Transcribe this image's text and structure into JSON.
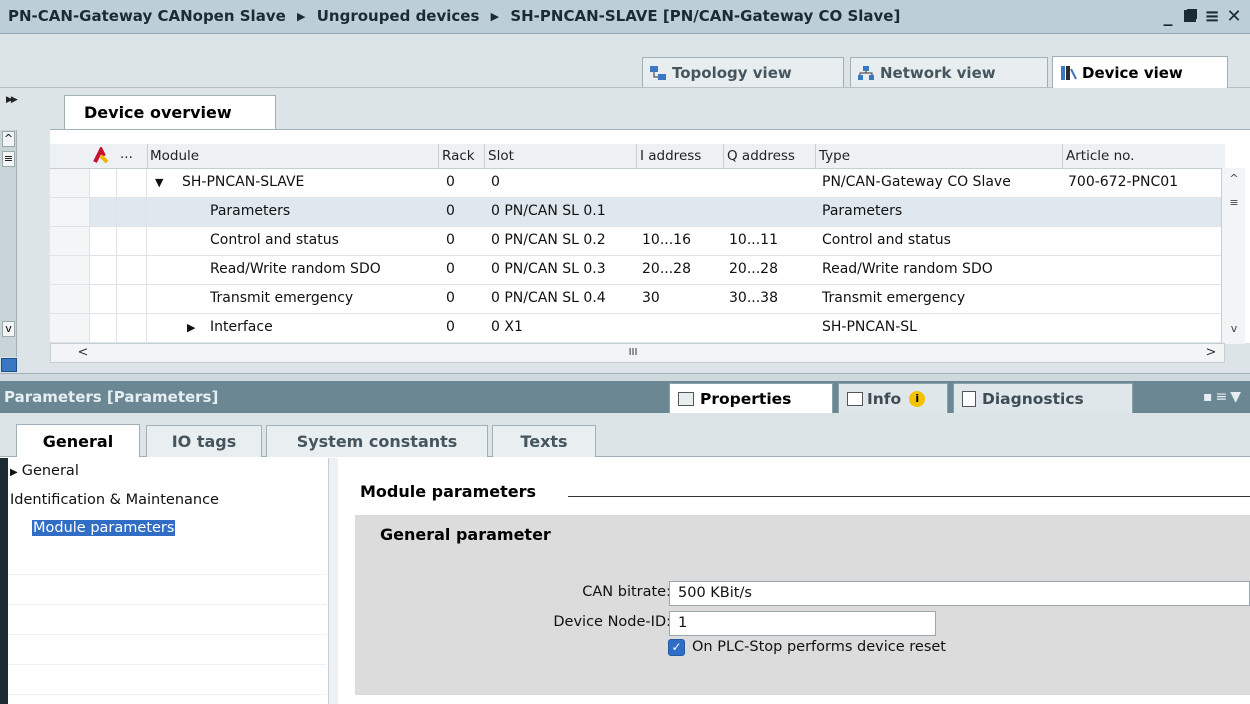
{
  "titlebar": {
    "crumbs": [
      "PN-CAN-Gateway CANopen Slave",
      "Ungrouped devices",
      "SH-PNCAN-SLAVE [PN/CAN-Gateway CO Slave]"
    ],
    "separator": "▶",
    "minimize": "_",
    "restore": "▪",
    "maximize": "≡",
    "close": "✕"
  },
  "views": {
    "topology": "Topology view",
    "network": "Network view",
    "device": "Device view"
  },
  "overview": {
    "tab_label": "Device overview",
    "ellipsis": "...",
    "columns": {
      "module": "Module",
      "rack": "Rack",
      "slot": "Slot",
      "iaddr": "I address",
      "qaddr": "Q address",
      "type": "Type",
      "article": "Article no."
    },
    "rows": [
      {
        "module": "SH-PNCAN-SLAVE",
        "rack": "0",
        "slot": "0",
        "iaddr": "",
        "qaddr": "",
        "type": "PN/CAN-Gateway CO Slave",
        "article": "700-672-PNC01",
        "expander": "▼"
      },
      {
        "module": "Parameters",
        "rack": "0",
        "slot": "0 PN/CAN SL 0.1",
        "iaddr": "",
        "qaddr": "",
        "type": "Parameters",
        "article": "",
        "expander": ""
      },
      {
        "module": "Control and status",
        "rack": "0",
        "slot": "0 PN/CAN SL 0.2",
        "iaddr": "10...16",
        "qaddr": "10...11",
        "type": "Control and status",
        "article": "",
        "expander": ""
      },
      {
        "module": "Read/Write random SDO",
        "rack": "0",
        "slot": "0 PN/CAN SL 0.3",
        "iaddr": "20...28",
        "qaddr": "20...28",
        "type": "Read/Write random SDO",
        "article": "",
        "expander": ""
      },
      {
        "module": "Transmit emergency",
        "rack": "0",
        "slot": "0 PN/CAN SL 0.4",
        "iaddr": "30",
        "qaddr": "30...38",
        "type": "Transmit emergency",
        "article": "",
        "expander": ""
      },
      {
        "module": "Interface",
        "rack": "0",
        "slot": "0 X1",
        "iaddr": "",
        "qaddr": "",
        "type": "SH-PNCAN-SL",
        "article": "",
        "expander": "▶"
      }
    ],
    "hscroll_mid": "III"
  },
  "properties": {
    "title": "Parameters [Parameters]",
    "tabs": {
      "properties": "Properties",
      "info": "Info",
      "diagnostics": "Diagnostics"
    },
    "subtabs": [
      "General",
      "IO tags",
      "System constants",
      "Texts"
    ],
    "nav": [
      "General",
      "Identification & Maintenance",
      "Module parameters"
    ],
    "section_title": "Module parameters",
    "group_title": "General parameter",
    "fields": {
      "can_bitrate_label": "CAN bitrate:",
      "can_bitrate_value": "500 KBit/s",
      "node_id_label": "Device Node-ID:",
      "node_id_value": "1",
      "reset_label": "On PLC-Stop performs device reset"
    }
  }
}
